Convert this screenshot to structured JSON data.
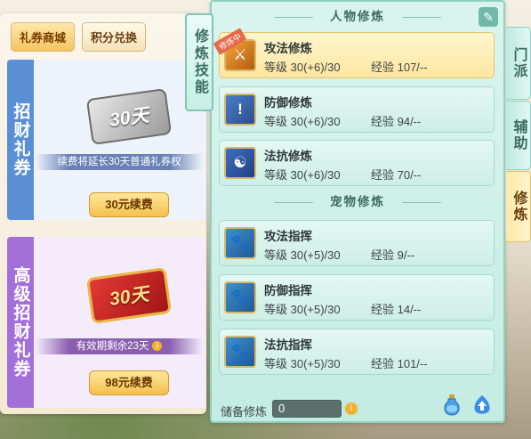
{
  "shop": {
    "tabs": [
      "礼券商城",
      "积分兑换"
    ],
    "cards": [
      {
        "side_label": "招财礼券",
        "ticket_text": "30天",
        "info": "续费将延长30天普通礼券权",
        "button": "30元续费"
      },
      {
        "side_label": "高级招财礼券",
        "ticket_text": "30天",
        "info": "有效期剩余23天",
        "button": "98元续费"
      }
    ]
  },
  "skill_tag": "修炼技能",
  "panel": {
    "sections": [
      {
        "title": "人物修炼",
        "items": [
          {
            "name": "攻法修炼",
            "level": "等级 30(+6)/30",
            "exp": "经验 107/--",
            "badge": "修炼中",
            "icon": "sword-spell-icon",
            "selected": true
          },
          {
            "name": "防御修炼",
            "level": "等级 30(+6)/30",
            "exp": "经验 94/--",
            "badge": "",
            "icon": "shield-icon",
            "selected": false
          },
          {
            "name": "法抗修炼",
            "level": "等级 30(+6)/30",
            "exp": "经验 70/--",
            "badge": "",
            "icon": "yin-yang-icon",
            "selected": false
          }
        ]
      },
      {
        "title": "宠物修炼",
        "items": [
          {
            "name": "攻法指挥",
            "level": "等级 30(+5)/30",
            "exp": "经验 9/--",
            "badge": "",
            "icon": "paw-attack-icon",
            "selected": false
          },
          {
            "name": "防御指挥",
            "level": "等级 30(+5)/30",
            "exp": "经验 14/--",
            "badge": "",
            "icon": "paw-shield-icon",
            "selected": false
          },
          {
            "name": "法抗指挥",
            "level": "等级 30(+5)/30",
            "exp": "经验 101/--",
            "badge": "",
            "icon": "paw-resist-icon",
            "selected": false
          }
        ]
      }
    ],
    "footer": {
      "label": "储备修炼",
      "value": "0"
    }
  },
  "right_tabs": [
    "门派",
    "辅助",
    "修炼"
  ],
  "colors": {
    "panel_bg": "#c4ece2",
    "selected_row": "#fde6a0",
    "button_gold": "#f5c04e"
  }
}
